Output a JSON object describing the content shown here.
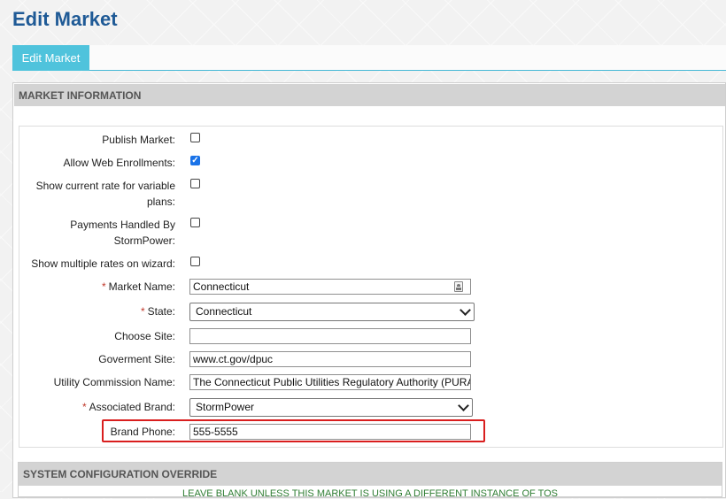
{
  "page": {
    "title": "Edit Market"
  },
  "tabs": [
    {
      "label": "Edit Market",
      "active": true
    }
  ],
  "market_info": {
    "header": "MARKET INFORMATION",
    "fields": {
      "publish_market": {
        "label": "Publish Market:",
        "checked": false
      },
      "allow_web_enrollments": {
        "label": "Allow Web Enrollments:",
        "checked": true
      },
      "show_current_rate": {
        "label_line1": "Show current rate for variable",
        "label_line2": "plans:",
        "checked": false
      },
      "payments_handled": {
        "label_line1": "Payments Handled By",
        "label_line2": "StormPower:",
        "checked": false
      },
      "show_multiple_rates": {
        "label": "Show multiple rates on wizard:",
        "checked": false
      },
      "market_name": {
        "label": "Market Name:",
        "required_mark": "*",
        "value": "Connecticut"
      },
      "state": {
        "label": "State:",
        "required_mark": "*",
        "value": "Connecticut"
      },
      "choose_site": {
        "label": "Choose Site:",
        "value": ""
      },
      "government_site": {
        "label": "Goverment Site:",
        "value": "www.ct.gov/dpuc"
      },
      "utility_commission": {
        "label": "Utility Commission Name:",
        "value": "The Connecticut Public Utilities Regulatory Authority (PURA)"
      },
      "associated_brand": {
        "label": "Associated Brand:",
        "required_mark": "*",
        "value": "StormPower"
      },
      "brand_phone": {
        "label": "Brand Phone:",
        "value": "555-5555"
      }
    }
  },
  "system_config": {
    "header": "SYSTEM CONFIGURATION OVERRIDE",
    "note_partial": "LEAVE BLANK UNLESS THIS MARKET IS USING A DIFFERENT INSTANCE OF TOS"
  },
  "colors": {
    "title_blue": "#1f5a96",
    "tab_cyan": "#4fc3dc",
    "checkbox_blue": "#1a73e8",
    "highlight_red": "#d91e1e",
    "required_red": "#c0392b"
  }
}
